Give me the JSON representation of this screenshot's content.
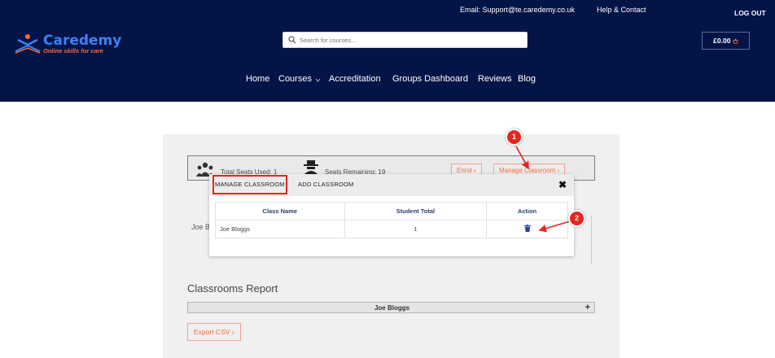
{
  "header": {
    "email": "Email: Support@te.caredemy.co.uk",
    "help": "Help & Contact",
    "logout": "LOG OUT",
    "brand": "Caredemy",
    "tagline": "Online skills for care",
    "search_placeholder": "Search for courses...",
    "cart": "£0.00",
    "nav": [
      "Home",
      "Courses",
      "Accreditation",
      "Groups Dashboard",
      "Reviews",
      "Blog"
    ]
  },
  "background": {
    "total_seats": "Total Seats Used: 1",
    "seats_remaining": "Seats Remaining: 19",
    "enrol_label": "Enrol",
    "manage_label": "Manage Classroom",
    "joe_partial": "Joe B",
    "reports_title": "Classrooms Report",
    "report_row": "Joe Bloggs",
    "report_plus": "+",
    "export": "Export CSV"
  },
  "modal": {
    "tabs": [
      "MANAGE CLASSROOM",
      "ADD CLASSROOM"
    ],
    "close": "✖",
    "columns": [
      "Class Name",
      "Student Total",
      "Action"
    ],
    "rows": [
      {
        "class_name": "Joe Bloggs",
        "student_total": "1"
      }
    ]
  },
  "annotations": [
    "1",
    "2"
  ],
  "colors": {
    "header_bg": "#051447",
    "accent_orange": "#f26b3a",
    "marker_red": "#e52521",
    "table_header": "#2c3d6e"
  }
}
